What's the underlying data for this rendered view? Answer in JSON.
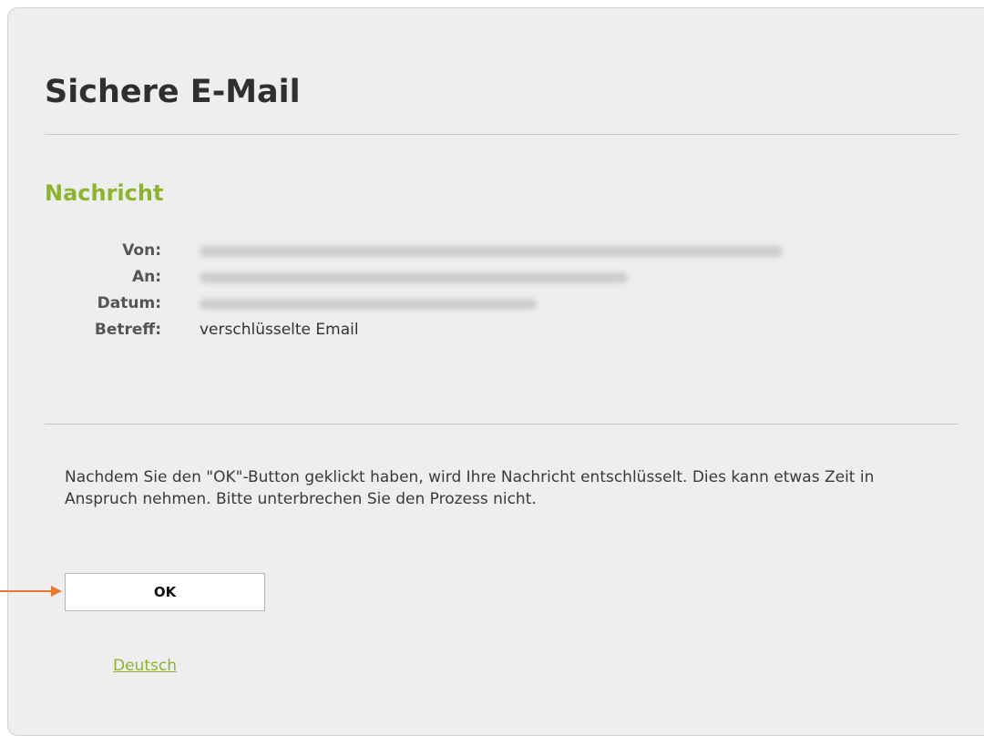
{
  "header": {
    "title": "Sichere E-Mail"
  },
  "message": {
    "section_title": "Nachricht",
    "fields": [
      {
        "label": "Von:",
        "value": "",
        "redacted": true
      },
      {
        "label": "An:",
        "value": "",
        "redacted": true
      },
      {
        "label": "Datum:",
        "value": "",
        "redacted": true
      },
      {
        "label": "Betreff:",
        "value": "verschlüsselte Email",
        "redacted": false
      }
    ]
  },
  "notice": {
    "text": "Nachdem Sie den \"OK\"-Button geklickt haben, wird Ihre Nachricht entschlüsselt. Dies kann etwas Zeit in Anspruch nehmen. Bitte unterbrechen Sie den Prozess nicht."
  },
  "actions": {
    "ok_label": "OK"
  },
  "footer": {
    "language_label": "Deutsch"
  },
  "colors": {
    "accent": "#8db32f",
    "arrow": "#e8782e",
    "panel_background": "#eeeeee",
    "title_text": "#2f2f2f"
  },
  "icons": {
    "pointer_arrow": "arrow-right-icon"
  }
}
